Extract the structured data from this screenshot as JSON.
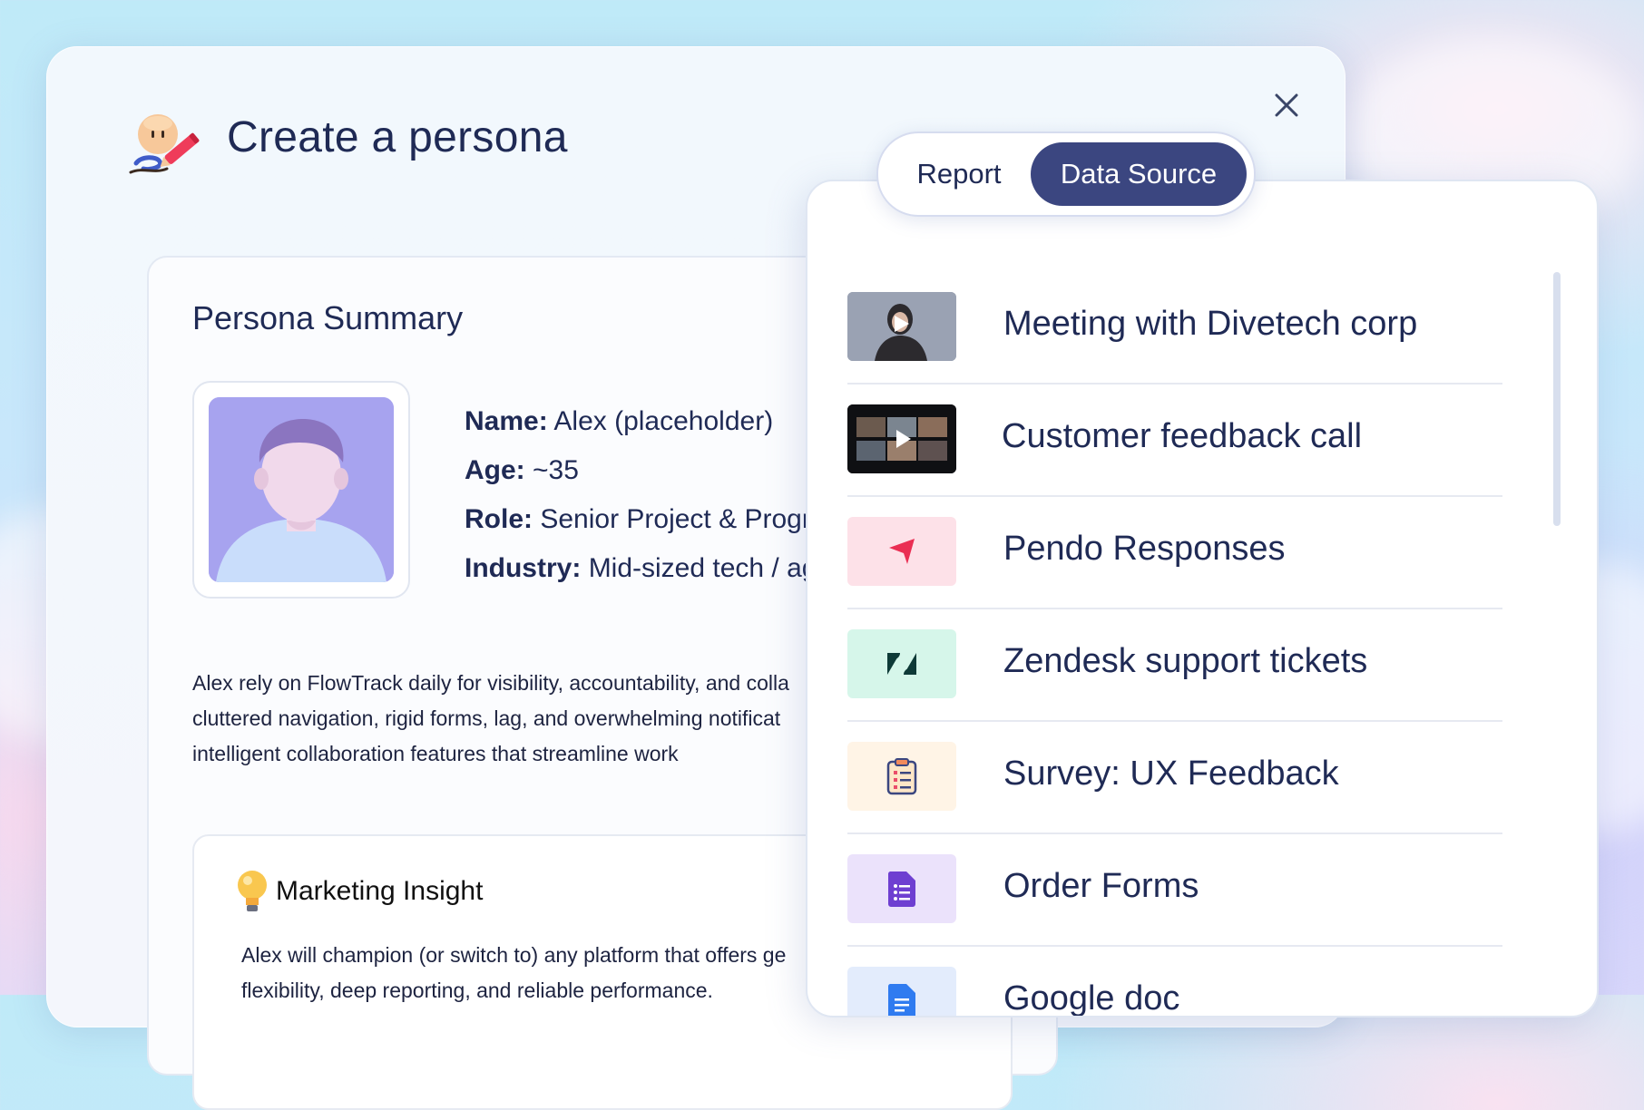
{
  "modal": {
    "title": "Create a persona",
    "close_icon": "close-icon"
  },
  "summary": {
    "title": "Persona Summary",
    "name_key": "Name:",
    "name_val": "Alex (placeholder)",
    "age_key": "Age:",
    "age_val": "~35",
    "role_key": "Role:",
    "role_val": "Senior Project & Program",
    "industry_key": "Industry:",
    "industry_val": "Mid-sized tech / age",
    "paragraph": [
      "Alex rely on FlowTrack daily for visibility, accountability, and colla",
      "cluttered navigation, rigid forms, lag, and overwhelming notificat",
      "intelligent collaboration features that streamline work"
    ],
    "insight": {
      "title": "Marketing Insight",
      "lines": [
        "Alex will champion (or switch to) any platform that offers ge",
        "flexibility, deep reporting, and reliable performance."
      ]
    }
  },
  "toggle": {
    "report": "Report",
    "data_source": "Data Source",
    "selected": "Data Source"
  },
  "data_sources": [
    {
      "label": "Meeting with Divetech corp",
      "icon": "video-thumbnail-icon"
    },
    {
      "label": "Customer feedback call",
      "icon": "video-call-thumbnail-icon"
    },
    {
      "label": "Pendo Responses",
      "icon": "pendo-icon"
    },
    {
      "label": "Zendesk support tickets",
      "icon": "zendesk-icon"
    },
    {
      "label": "Survey: UX Feedback",
      "icon": "clipboard-icon"
    },
    {
      "label": "Order Forms",
      "icon": "forms-icon"
    },
    {
      "label": "Google doc",
      "icon": "google-doc-icon"
    }
  ],
  "colors": {
    "title": "#1f2a55",
    "toggle_active": "#3b4680",
    "avatar_bg": "#a7a3ef"
  }
}
